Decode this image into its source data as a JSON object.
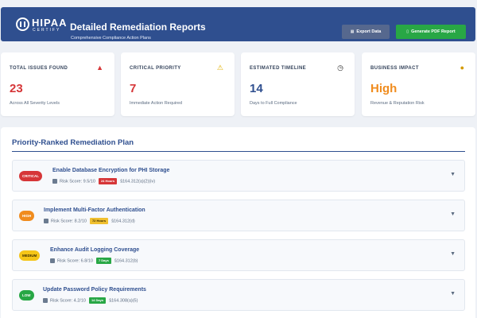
{
  "header": {
    "logo_word": "HIPAA",
    "logo_sub": "CERTIFY",
    "title": "Detailed Remediation Reports",
    "subtitle": "Comprehensive Compliance Action Plans",
    "export_label": "Export Data",
    "pdf_label": "Generate PDF Report",
    "export_icon": "download-icon",
    "pdf_icon": "document-icon"
  },
  "cards": [
    {
      "label": "TOTAL ISSUES FOUND",
      "icon": "alarm-icon",
      "value": "23",
      "value_color": "#d63638",
      "sub": "Across All Severity Levels"
    },
    {
      "label": "CRITICAL PRIORITY",
      "icon": "warning-icon",
      "value": "7",
      "value_color": "#d63638",
      "sub": "Immediate Action Required"
    },
    {
      "label": "ESTIMATED TIMELINE",
      "icon": "stopwatch-icon",
      "value": "14",
      "value_color": "#2f4f8f",
      "sub": "Days to Full Compliance"
    },
    {
      "label": "BUSINESS IMPACT",
      "icon": "medal-icon",
      "value": "High",
      "value_color": "#f08c1e",
      "sub": "Revenue & Reputation Risk"
    }
  ],
  "plan": {
    "title": "Priority-Ranked Remediation Plan",
    "items": [
      {
        "severity": "CRITICAL",
        "severity_color": "#d63638",
        "title": "Enable Database Encryption for PHI Storage",
        "risk": "Risk Score: 9.5/10",
        "timeframe": "24 Hours",
        "timeframe_color": "#d63638",
        "citation": "§164.312(a)(2)(iv)"
      },
      {
        "severity": "HIGH",
        "severity_color": "#f08c1e",
        "title": "Implement Multi-Factor Authentication",
        "risk": "Risk Score: 8.2/10",
        "timeframe": "72 Hours",
        "timeframe_color": "#f0c030",
        "citation": "§164.312(d)"
      },
      {
        "severity": "MEDIUM",
        "severity_color": "#f5c518",
        "title": "Enhance Audit Logging Coverage",
        "risk": "Risk Score: 6.8/10",
        "timeframe": "7 Days",
        "timeframe_color": "#28a745",
        "citation": "§164.312(b)"
      },
      {
        "severity": "LOW",
        "severity_color": "#28a745",
        "title": "Update Password Policy Requirements",
        "risk": "Risk Score: 4.2/10",
        "timeframe": "14 Days",
        "timeframe_color": "#28a745",
        "citation": "§164.308(a)(5)"
      }
    ]
  },
  "colors": {
    "brand": "#2f4f8f",
    "critical": "#d63638",
    "high": "#f08c1e",
    "medium": "#f5c518",
    "low": "#28a745"
  }
}
